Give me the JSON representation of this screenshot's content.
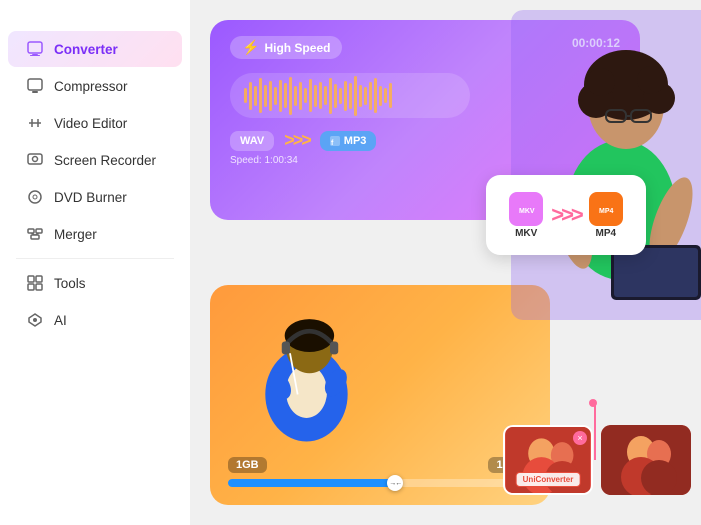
{
  "sidebar": {
    "items": [
      {
        "label": "Converter",
        "active": true,
        "icon": "🖥"
      },
      {
        "label": "Compressor",
        "active": false,
        "icon": "🗜"
      },
      {
        "label": "Video Editor",
        "active": false,
        "icon": "✂"
      },
      {
        "label": "Screen Recorder",
        "active": false,
        "icon": "📹"
      },
      {
        "label": "DVD Burner",
        "active": false,
        "icon": "💿"
      },
      {
        "label": "Merger",
        "active": false,
        "icon": "🔗"
      },
      {
        "label": "Tools",
        "active": false,
        "icon": "⚙"
      },
      {
        "label": "AI",
        "active": false,
        "icon": "◇"
      }
    ]
  },
  "card_purple": {
    "badge_label": "High Speed",
    "timer": "00:00:12",
    "from_format": "WAV",
    "to_format": "MP3",
    "speed_text": "Speed: 1:00:34"
  },
  "card_conversion": {
    "from_format": "MKV",
    "to_format": "MP4"
  },
  "card_orange": {
    "label_left": "1GB",
    "label_right": "100M"
  },
  "uniconverter_badge": "UniConverter",
  "app_title": "UniConverter"
}
